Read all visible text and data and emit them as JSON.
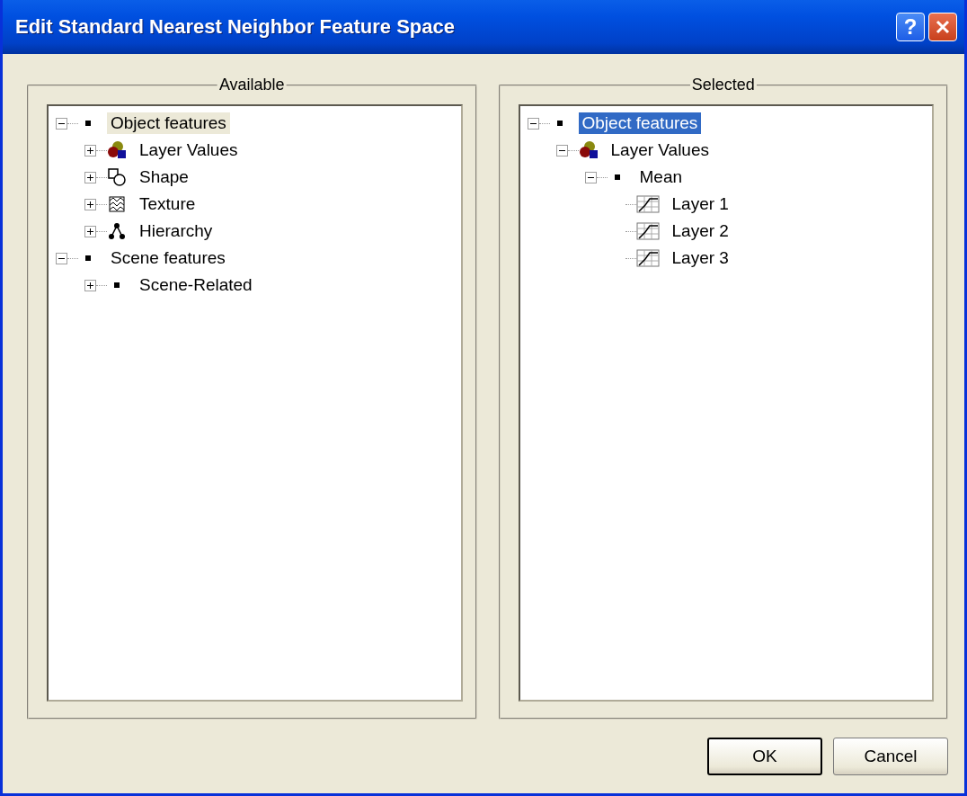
{
  "window": {
    "title": "Edit Standard Nearest Neighbor Feature Space",
    "help_button": "?"
  },
  "panels": [
    {
      "title": "Available",
      "focused": false,
      "tree": [
        {
          "label": "Object features",
          "kind": "bullet",
          "expanded": true,
          "selected": true,
          "children": [
            {
              "label": "Layer Values",
              "kind": "layers",
              "expanded": false,
              "selected": false
            },
            {
              "label": "Shape",
              "kind": "shape",
              "expanded": false,
              "selected": false
            },
            {
              "label": "Texture",
              "kind": "texture",
              "expanded": false,
              "selected": false
            },
            {
              "label": "Hierarchy",
              "kind": "hierarchy",
              "expanded": false,
              "selected": false
            }
          ]
        },
        {
          "label": "Scene features",
          "kind": "bullet",
          "expanded": true,
          "selected": false,
          "children": [
            {
              "label": "Scene-Related",
              "kind": "bullet",
              "expanded": false,
              "selected": false
            }
          ]
        }
      ]
    },
    {
      "title": "Selected",
      "focused": true,
      "tree": [
        {
          "label": "Object features",
          "kind": "bullet",
          "expanded": true,
          "selected": true,
          "children": [
            {
              "label": "Layer Values",
              "kind": "layers",
              "expanded": true,
              "selected": false,
              "children": [
                {
                  "label": "Mean",
                  "kind": "bullet",
                  "expanded": true,
                  "selected": false,
                  "children": [
                    {
                      "label": "Layer 1",
                      "kind": "chart",
                      "selected": false
                    },
                    {
                      "label": "Layer 2",
                      "kind": "chart",
                      "selected": false
                    },
                    {
                      "label": "Layer 3",
                      "kind": "chart",
                      "selected": false
                    }
                  ]
                }
              ]
            }
          ]
        }
      ]
    }
  ],
  "buttons": [
    {
      "label": "OK",
      "default": true
    },
    {
      "label": "Cancel",
      "default": false
    }
  ]
}
